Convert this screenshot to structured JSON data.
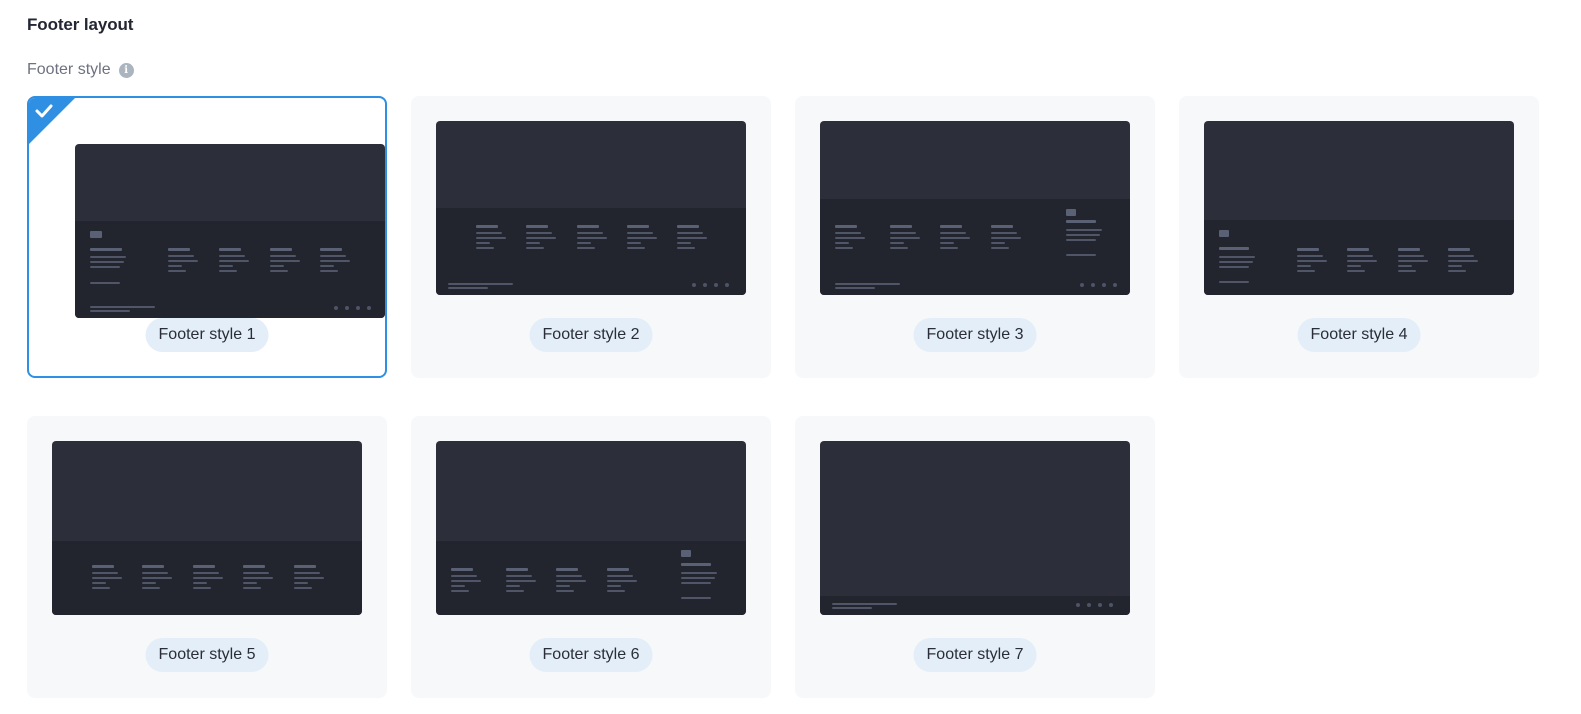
{
  "section_title": "Footer layout",
  "field_label": "Footer style",
  "info_icon": "info-icon",
  "selected_index": 0,
  "accent_color": "#2f8fe3",
  "styles": [
    {
      "label": "Footer style 1",
      "selected": true
    },
    {
      "label": "Footer style 2",
      "selected": false
    },
    {
      "label": "Footer style 3",
      "selected": false
    },
    {
      "label": "Footer style 4",
      "selected": false
    },
    {
      "label": "Footer style 5",
      "selected": false
    },
    {
      "label": "Footer style 6",
      "selected": false
    },
    {
      "label": "Footer style 7",
      "selected": false
    }
  ]
}
